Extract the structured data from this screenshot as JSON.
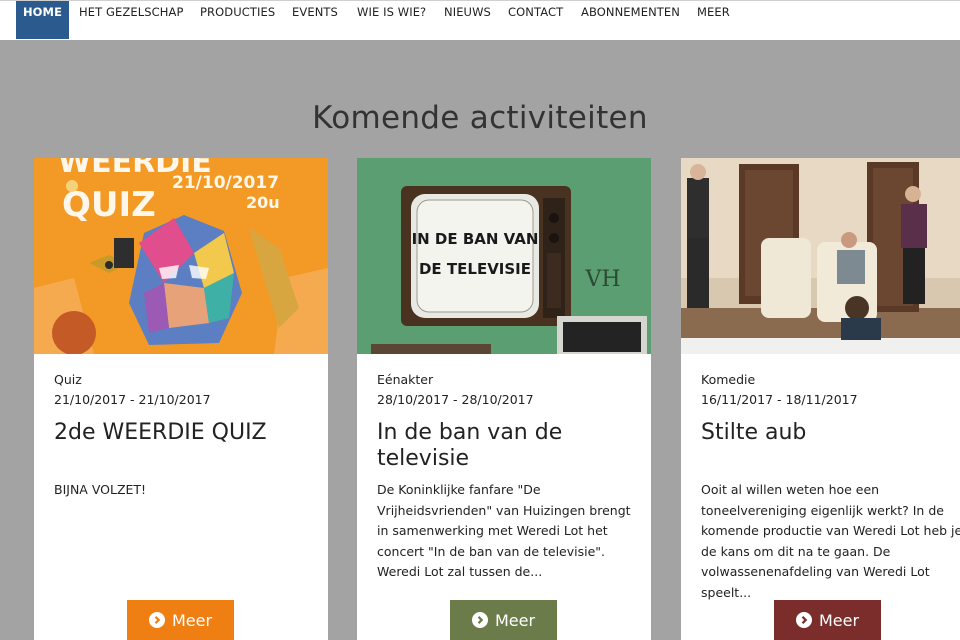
{
  "nav": {
    "items": [
      "HOME",
      "HET GEZELSCHAP",
      "PRODUCTIES",
      "EVENTS",
      "WIE IS WIE?",
      "NIEUWS",
      "CONTACT",
      "ABONNEMENTEN",
      "MEER"
    ]
  },
  "heading": "Komende activiteiten",
  "cards": [
    {
      "category": "Quiz",
      "dates": "21/10/2017 - 21/10/2017",
      "title": "2de WEERDIE QUIZ",
      "description": "BIJNA VOLZET!",
      "button_label": "Meer",
      "button_color": "#f07f13",
      "poster": {
        "line1": "WEERDIE",
        "line2": "QUIZ",
        "date": "21/10/2017",
        "time": "20u"
      }
    },
    {
      "category": "Eénakter",
      "dates": "28/10/2017 - 28/10/2017",
      "title": "In de ban van de televisie",
      "description": "De Koninklijke fanfare \"De Vrijheidsvrienden\" van Huizingen brengt in samenwerking met Weredi Lot het concert \"In de ban van de televisie\". Weredi Lot zal tussen de...",
      "button_label": "Meer",
      "button_color": "#6b7c4a",
      "poster": {
        "screen_line1": "IN DE BAN VAN",
        "screen_line2": "DE TELEVISIE",
        "monogram": "VH"
      }
    },
    {
      "category": "Komedie",
      "dates": "16/11/2017 - 18/11/2017",
      "title": "Stilte aub",
      "description": "Ooit al willen weten hoe een toneelvereniging eigenlijk werkt? In de komende productie van Weredi Lot heb je de kans om dit na te gaan. De volwassenenafdeling van Weredi Lot speelt...",
      "button_label": "Meer",
      "button_color": "#7a2d2a"
    }
  ]
}
